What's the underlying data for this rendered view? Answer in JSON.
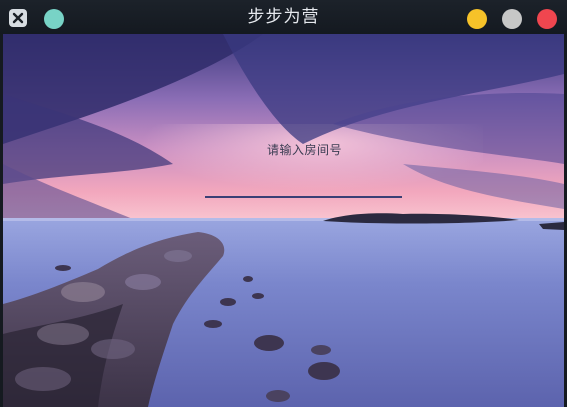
{
  "window": {
    "title": "步步为营"
  },
  "room_form": {
    "prompt_label": "请输入房间号",
    "input_value": ""
  },
  "colors": {
    "titlebar": "#151a20",
    "teal_dot": "#78d3c6",
    "minimize": "#f6c229",
    "maximize": "#c7c7c7",
    "close": "#f0464f",
    "input_underline": "#3b4075"
  },
  "icons": {
    "close": "close-icon",
    "app_dot": "app-icon"
  }
}
